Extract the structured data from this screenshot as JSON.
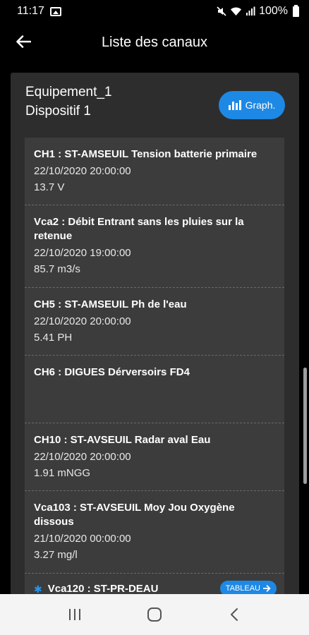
{
  "status_bar": {
    "time": "11:17",
    "battery": "100%"
  },
  "app_bar": {
    "title": "Liste des canaux"
  },
  "card": {
    "equipment": "Equipement_1",
    "device": "Dispositif 1",
    "graph_button": "Graph."
  },
  "channels": [
    {
      "title": "CH1 : ST-AMSEUIL Tension batterie primaire",
      "date": "22/10/2020 20:00:00",
      "value": "13.7 V"
    },
    {
      "title": "Vca2 : Débit Entrant sans les pluies sur la retenue",
      "date": "22/10/2020 19:00:00",
      "value": "85.7 m3/s"
    },
    {
      "title": "CH5 : ST-AMSEUIL Ph de l'eau",
      "date": "22/10/2020 20:00:00",
      "value": "5.41 PH"
    },
    {
      "title": "CH6 : DIGUES Dérversoirs FD4",
      "date": "",
      "value": ""
    },
    {
      "title": "CH10 : ST-AVSEUIL Radar aval Eau",
      "date": "22/10/2020 20:00:00",
      "value": "1.91 mNGG"
    },
    {
      "title": "Vca103 : ST-AVSEUIL Moy Jou Oxygène dissous",
      "date": "21/10/2020 00:00:00",
      "value": "3.27 mg/l"
    }
  ],
  "last_channel": {
    "title": "Vca120 : ST-PR-DEAU",
    "button": "TABLEAU"
  },
  "colors": {
    "accent": "#1e88e5",
    "card_bg": "#2d2d2d",
    "list_bg": "#3c3c3c"
  }
}
